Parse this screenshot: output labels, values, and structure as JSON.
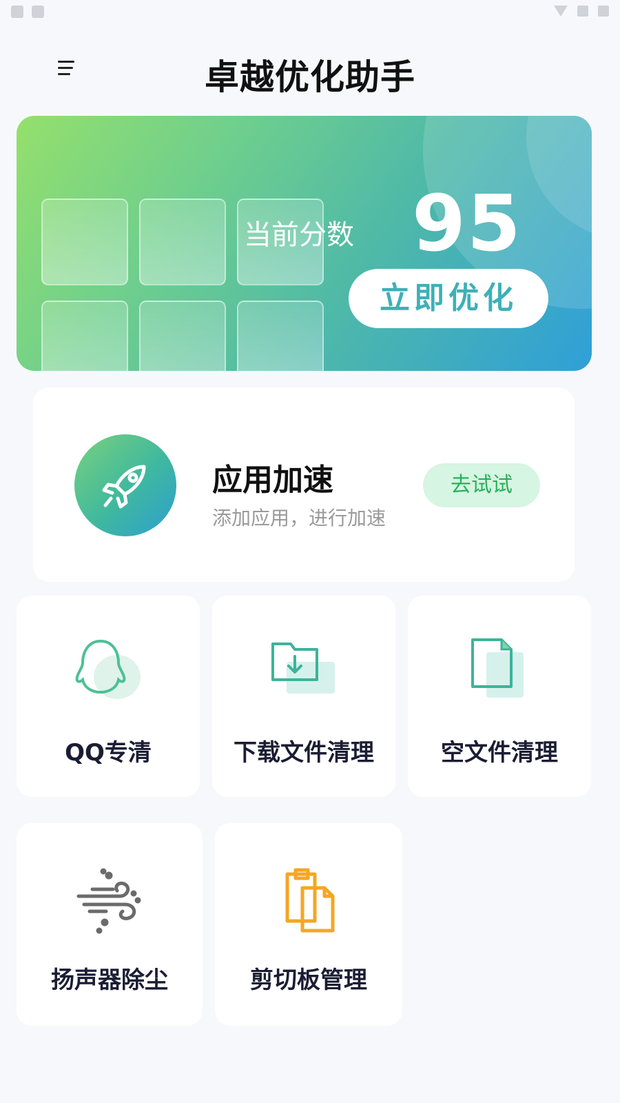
{
  "header": {
    "title": "卓越优化助手"
  },
  "hero": {
    "score_label": "当前分数",
    "score_value": "95",
    "optimize_button": "立即优化"
  },
  "accelerate": {
    "title": "应用加速",
    "subtitle": "添加应用，进行加速",
    "button": "去试试"
  },
  "features": [
    {
      "label": "QQ专清",
      "icon": "qq-penguin-icon"
    },
    {
      "label": "下载文件清理",
      "icon": "download-folder-icon"
    },
    {
      "label": "空文件清理",
      "icon": "empty-file-icon"
    },
    {
      "label": "扬声器除尘",
      "icon": "speaker-dust-icon"
    },
    {
      "label": "剪切板管理",
      "icon": "clipboard-icon"
    }
  ],
  "colors": {
    "accent": "#3db0b8",
    "try_bg": "#d6f5e2",
    "try_text": "#28b05a",
    "clipboard": "#f5a623"
  }
}
